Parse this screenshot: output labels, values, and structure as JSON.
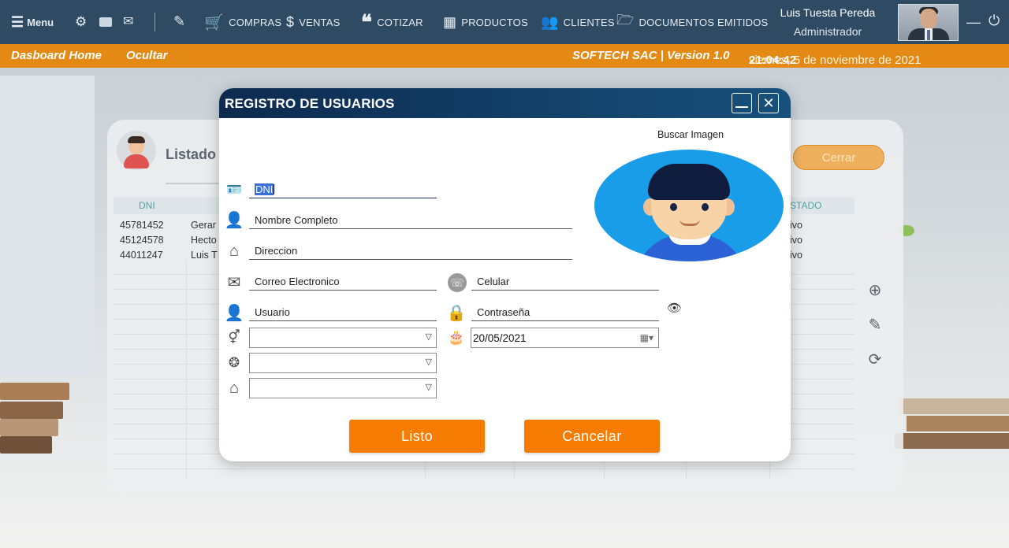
{
  "nav": {
    "menu_label": "Menu",
    "items": [
      {
        "label": "COMPRAS",
        "icon": "cart-icon"
      },
      {
        "label": "VENTAS",
        "icon": "money-hand-icon"
      },
      {
        "label": "COTIZAR",
        "icon": "quote-icon"
      },
      {
        "label": "PRODUCTOS",
        "icon": "boxes-icon"
      },
      {
        "label": "CLIENTES",
        "icon": "people-icon"
      },
      {
        "label": "DOCUMENTOS EMITIDOS",
        "icon": "folder-icon"
      }
    ],
    "user_name": "Luis Tuesta Pereda",
    "user_role": "Administrador"
  },
  "status": {
    "dashboard": "Dasboard Home",
    "ocultar": "Ocultar",
    "company": "SOFTECH SAC | Version 1.0",
    "date": "viernes, 5 de noviembre de 2021",
    "time": "21:04:42"
  },
  "listado": {
    "title": "Listado",
    "cerrar_label": "Cerrar",
    "col_dni": "DNI",
    "col_estado": "STADO",
    "rows": [
      {
        "dni": "45781452",
        "name": "Gerar",
        "estado": "ivo"
      },
      {
        "dni": "45124578",
        "name": "Hecto",
        "estado": "ivo"
      },
      {
        "dni": "44011247",
        "name": "Luis T",
        "estado": "ivo"
      }
    ]
  },
  "modal": {
    "title": "REGISTRO DE USUARIOS",
    "buscar_imagen": "Buscar Imagen",
    "fields": {
      "dni": "DNI",
      "nombre": "Nombre Completo",
      "direccion": "Direccion",
      "correo": "Correo Electronico",
      "celular": "Celular",
      "usuario": "Usuario",
      "contrasena": "Contraseña"
    },
    "fecha": "20/05/2021",
    "listo_label": "Listo",
    "cancelar_label": "Cancelar"
  },
  "colors": {
    "navbar": "#2f4a63",
    "statusbar": "#e48a14",
    "modal_header": "#0e2a4f",
    "button_orange": "#f57c00",
    "photo_bg": "#1a9de8"
  }
}
